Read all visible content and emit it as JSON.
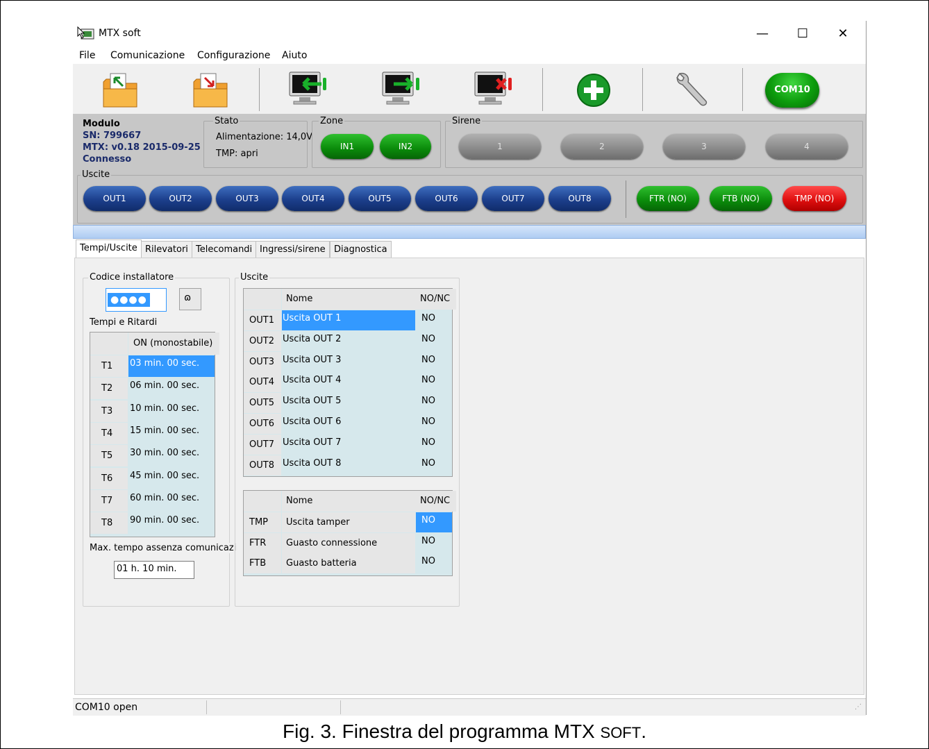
{
  "app": {
    "title": "MTX soft"
  },
  "window_controls": {
    "minimize": "—",
    "maximize": "☐",
    "close": "✕"
  },
  "menu": [
    "File",
    "Comunicazione",
    "Configurazione",
    "Aiuto"
  ],
  "toolbar": {
    "com_port": "COM10"
  },
  "module": {
    "label": "Modulo",
    "sn": "SN: 799667",
    "version": "MTX: v0.18 2015-09-25",
    "connection": "Connesso"
  },
  "stato": {
    "label": "Stato",
    "alimentazione": "Alimentazione: 14,0V",
    "tmp": "TMP: apri"
  },
  "zone": {
    "label": "Zone",
    "items": [
      "IN1",
      "IN2"
    ]
  },
  "sirene": {
    "label": "Sirene",
    "items": [
      "1",
      "2",
      "3",
      "4"
    ]
  },
  "uscite_bar": {
    "label": "Uscite",
    "outputs": [
      "OUT1",
      "OUT2",
      "OUT3",
      "OUT4",
      "OUT5",
      "OUT6",
      "OUT7",
      "OUT8"
    ],
    "status": [
      "FTR (NO)",
      "FTB (NO)",
      "TMP (NO)"
    ]
  },
  "tabs": [
    "Tempi/Uscite",
    "Rilevatori",
    "Telecomandi",
    "Ingressi/sirene",
    "Diagnostica"
  ],
  "codice": {
    "label": "Codice installatore",
    "value": "●●●●",
    "show_icon": "ɷ"
  },
  "tempi": {
    "label": "Tempi e Ritardi",
    "header": "ON (monostabile)",
    "rows": [
      {
        "id": "T1",
        "value": "03 min. 00 sec."
      },
      {
        "id": "T2",
        "value": "06 min. 00 sec."
      },
      {
        "id": "T3",
        "value": "10 min. 00 sec."
      },
      {
        "id": "T4",
        "value": "15 min. 00 sec."
      },
      {
        "id": "T5",
        "value": "30 min. 00 sec."
      },
      {
        "id": "T6",
        "value": "45 min. 00 sec."
      },
      {
        "id": "T7",
        "value": "60 min. 00 sec."
      },
      {
        "id": "T8",
        "value": "90 min. 00 sec."
      }
    ]
  },
  "max_tempo": {
    "label": "Max. tempo assenza comunicazi",
    "value": "01 h. 10 min."
  },
  "uscite_table": {
    "label": "Uscite",
    "col_nome": "Nome",
    "col_nonc": "NO/NC",
    "rows": [
      {
        "id": "OUT1",
        "nome": "Uscita OUT 1",
        "nonc": "NO"
      },
      {
        "id": "OUT2",
        "nome": "Uscita OUT 2",
        "nonc": "NO"
      },
      {
        "id": "OUT3",
        "nome": "Uscita OUT 3",
        "nonc": "NO"
      },
      {
        "id": "OUT4",
        "nome": "Uscita OUT 4",
        "nonc": "NO"
      },
      {
        "id": "OUT5",
        "nome": "Uscita OUT 5",
        "nonc": "NO"
      },
      {
        "id": "OUT6",
        "nome": "Uscita OUT 6",
        "nonc": "NO"
      },
      {
        "id": "OUT7",
        "nome": "Uscita OUT 7",
        "nonc": "NO"
      },
      {
        "id": "OUT8",
        "nome": "Uscita OUT 8",
        "nonc": "NO"
      }
    ]
  },
  "speciali_table": {
    "col_nome": "Nome",
    "col_nonc": "NO/NC",
    "rows": [
      {
        "id": "TMP",
        "nome": "Uscita tamper",
        "nonc": "NO"
      },
      {
        "id": "FTR",
        "nome": "Guasto connessione",
        "nonc": "NO"
      },
      {
        "id": "FTB",
        "nome": "Guasto batteria",
        "nonc": "NO"
      }
    ]
  },
  "statusbar": {
    "text": "COM10 open"
  },
  "caption": {
    "main": "Fig. 3. Finestra del programma MTX ",
    "small": "SOFT",
    "end": "."
  },
  "colors": {
    "green": "#0a8a0a",
    "blue": "#1c3f8c",
    "red": "#e01010",
    "gray": "#8c8c8c",
    "selection": "#3399ff"
  }
}
